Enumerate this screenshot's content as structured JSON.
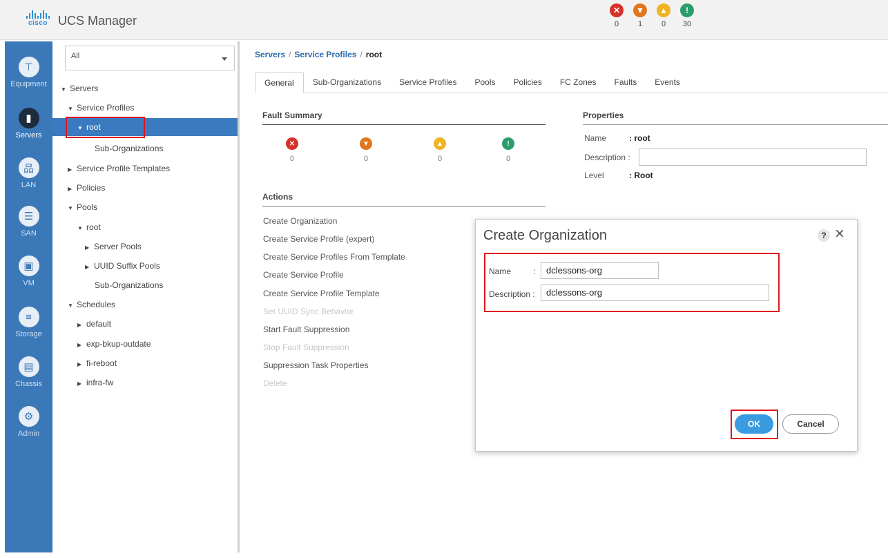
{
  "header": {
    "brand": "cisco",
    "title": "UCS Manager",
    "status": [
      {
        "icon": "critical-icon",
        "count": "0",
        "color": "#d8312a"
      },
      {
        "icon": "major-icon",
        "count": "1",
        "color": "#e2761e"
      },
      {
        "icon": "minor-icon",
        "count": "0",
        "color": "#f0b323"
      },
      {
        "icon": "warning-icon",
        "count": "30",
        "color": "#2a9e6a"
      }
    ]
  },
  "nav": {
    "items": [
      {
        "label": "Equipment",
        "icon": "equipment-icon"
      },
      {
        "label": "Servers",
        "icon": "servers-icon"
      },
      {
        "label": "LAN",
        "icon": "lan-icon"
      },
      {
        "label": "SAN",
        "icon": "san-icon"
      },
      {
        "label": "VM",
        "icon": "vm-icon"
      },
      {
        "label": "Storage",
        "icon": "storage-icon"
      },
      {
        "label": "Chassis",
        "icon": "chassis-icon"
      },
      {
        "label": "Admin",
        "icon": "admin-icon"
      }
    ],
    "active": "Servers"
  },
  "tree": {
    "filter_value": "All",
    "rows": [
      {
        "label": "Servers",
        "arrow": "down"
      },
      {
        "label": "Service Profiles",
        "arrow": "down"
      },
      {
        "label": "root",
        "arrow": "down",
        "selected": true
      },
      {
        "label": "Sub-Organizations",
        "arrow": ""
      },
      {
        "label": "Service Profile Templates",
        "arrow": "right"
      },
      {
        "label": "Policies",
        "arrow": "right"
      },
      {
        "label": "Pools",
        "arrow": "down"
      },
      {
        "label": "root",
        "arrow": "down"
      },
      {
        "label": "Server Pools",
        "arrow": "right"
      },
      {
        "label": "UUID Suffix Pools",
        "arrow": "right"
      },
      {
        "label": "Sub-Organizations",
        "arrow": ""
      },
      {
        "label": "Schedules",
        "arrow": "down"
      },
      {
        "label": "default",
        "arrow": "right"
      },
      {
        "label": "exp-bkup-outdate",
        "arrow": "right"
      },
      {
        "label": "fi-reboot",
        "arrow": "right"
      },
      {
        "label": "infra-fw",
        "arrow": "right"
      }
    ]
  },
  "main": {
    "breadcrumb": [
      "Servers",
      "Service Profiles",
      "root"
    ],
    "tabs": [
      "General",
      "Sub-Organizations",
      "Service Profiles",
      "Pools",
      "Policies",
      "FC Zones",
      "Faults",
      "Events"
    ],
    "active_tab": "General",
    "fault_summary": {
      "title": "Fault Summary",
      "items": [
        {
          "icon": "critical-icon",
          "count": "0",
          "color": "#d8312a"
        },
        {
          "icon": "major-icon",
          "count": "0",
          "color": "#e2761e"
        },
        {
          "icon": "minor-icon",
          "count": "0",
          "color": "#f0b323"
        },
        {
          "icon": "warning-icon",
          "count": "0",
          "color": "#2a9e6a"
        }
      ]
    },
    "actions": {
      "title": "Actions",
      "items": [
        {
          "label": "Create Organization",
          "enabled": true
        },
        {
          "label": "Create Service Profile (expert)",
          "enabled": true
        },
        {
          "label": "Create Service Profiles From Template",
          "enabled": true
        },
        {
          "label": "Create Service Profile",
          "enabled": true
        },
        {
          "label": "Create Service Profile Template",
          "enabled": true
        },
        {
          "label": "Set UUID Sync Behavior",
          "enabled": false
        },
        {
          "label": "Start Fault Suppression",
          "enabled": true
        },
        {
          "label": "Stop Fault Suppression",
          "enabled": false
        },
        {
          "label": "Suppression Task Properties",
          "enabled": true
        },
        {
          "label": "Delete",
          "enabled": false
        }
      ]
    },
    "properties": {
      "title": "Properties",
      "name_label": "Name",
      "name_value": ": root",
      "description_label": "Description :",
      "description_value": "",
      "level_label": "Level",
      "level_value": ": Root"
    }
  },
  "dialog": {
    "title": "Create Organization",
    "help": "?",
    "close": "×",
    "name_label": "Name",
    "name_colon": ":",
    "name_value": "dclessons-org",
    "description_label": "Description :",
    "description_value": "dclessons-org",
    "ok_label": "OK",
    "cancel_label": "Cancel"
  }
}
